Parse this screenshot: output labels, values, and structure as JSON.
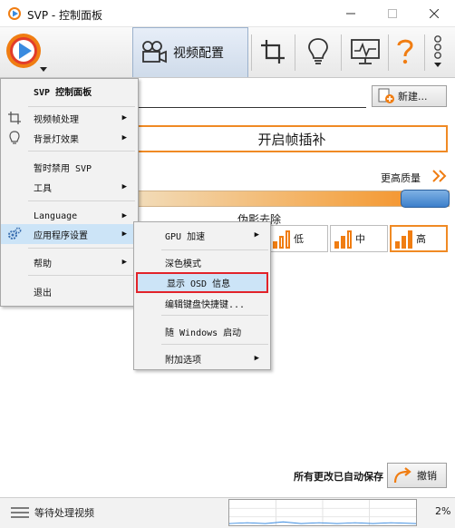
{
  "window": {
    "title": "SVP - 控制面板",
    "minimize_icon": "minimize-icon",
    "maximize_icon": "maximize-icon",
    "close_icon": "close-icon"
  },
  "toolbar": {
    "video_tab_label": "视频配置",
    "tools": [
      "crop-icon",
      "lightbulb-icon",
      "monitor-graph-icon",
      "help-icon",
      "more-icon"
    ]
  },
  "main": {
    "new_button": "新建...",
    "frame_interpolation": "开启帧插补",
    "higher_quality": "更高质量",
    "quality_level": 1.0,
    "artifact_removal": "伪影去除",
    "artifact_options": [
      {
        "label": "低",
        "bars": 1
      },
      {
        "label": "中",
        "bars": 2
      },
      {
        "label": "高",
        "bars": 3
      }
    ],
    "all_saved": "所有更改已自动保存",
    "undo_button": "撤销"
  },
  "main_menu": {
    "title": "SVP 控制面板",
    "items": [
      {
        "label": "视频帧处理",
        "submenu": true
      },
      {
        "label": "背景灯效果",
        "submenu": true
      },
      {
        "label": "暂时禁用 SVP",
        "submenu": false
      },
      {
        "label": "工具",
        "submenu": true
      },
      {
        "label": "Language",
        "submenu": true
      },
      {
        "label": "应用程序设置",
        "submenu": true
      },
      {
        "label": "帮助",
        "submenu": true
      },
      {
        "label": "退出",
        "submenu": false
      }
    ]
  },
  "settings_submenu": {
    "items": [
      {
        "label": "GPU 加速",
        "submenu": true
      },
      {
        "label": "深色模式",
        "submenu": false
      },
      {
        "label": "显示 OSD 信息",
        "submenu": false
      },
      {
        "label": "编辑键盘快捷键...",
        "submenu": false
      },
      {
        "label": "随 Windows 启动",
        "submenu": false
      },
      {
        "label": "附加选项",
        "submenu": true
      }
    ]
  },
  "status": {
    "text": "等待处理视频",
    "cpu": "2%"
  },
  "colors": {
    "accent_orange": "#f08a24",
    "highlight_blue": "#cce4f7",
    "box_red": "#e2232a"
  }
}
